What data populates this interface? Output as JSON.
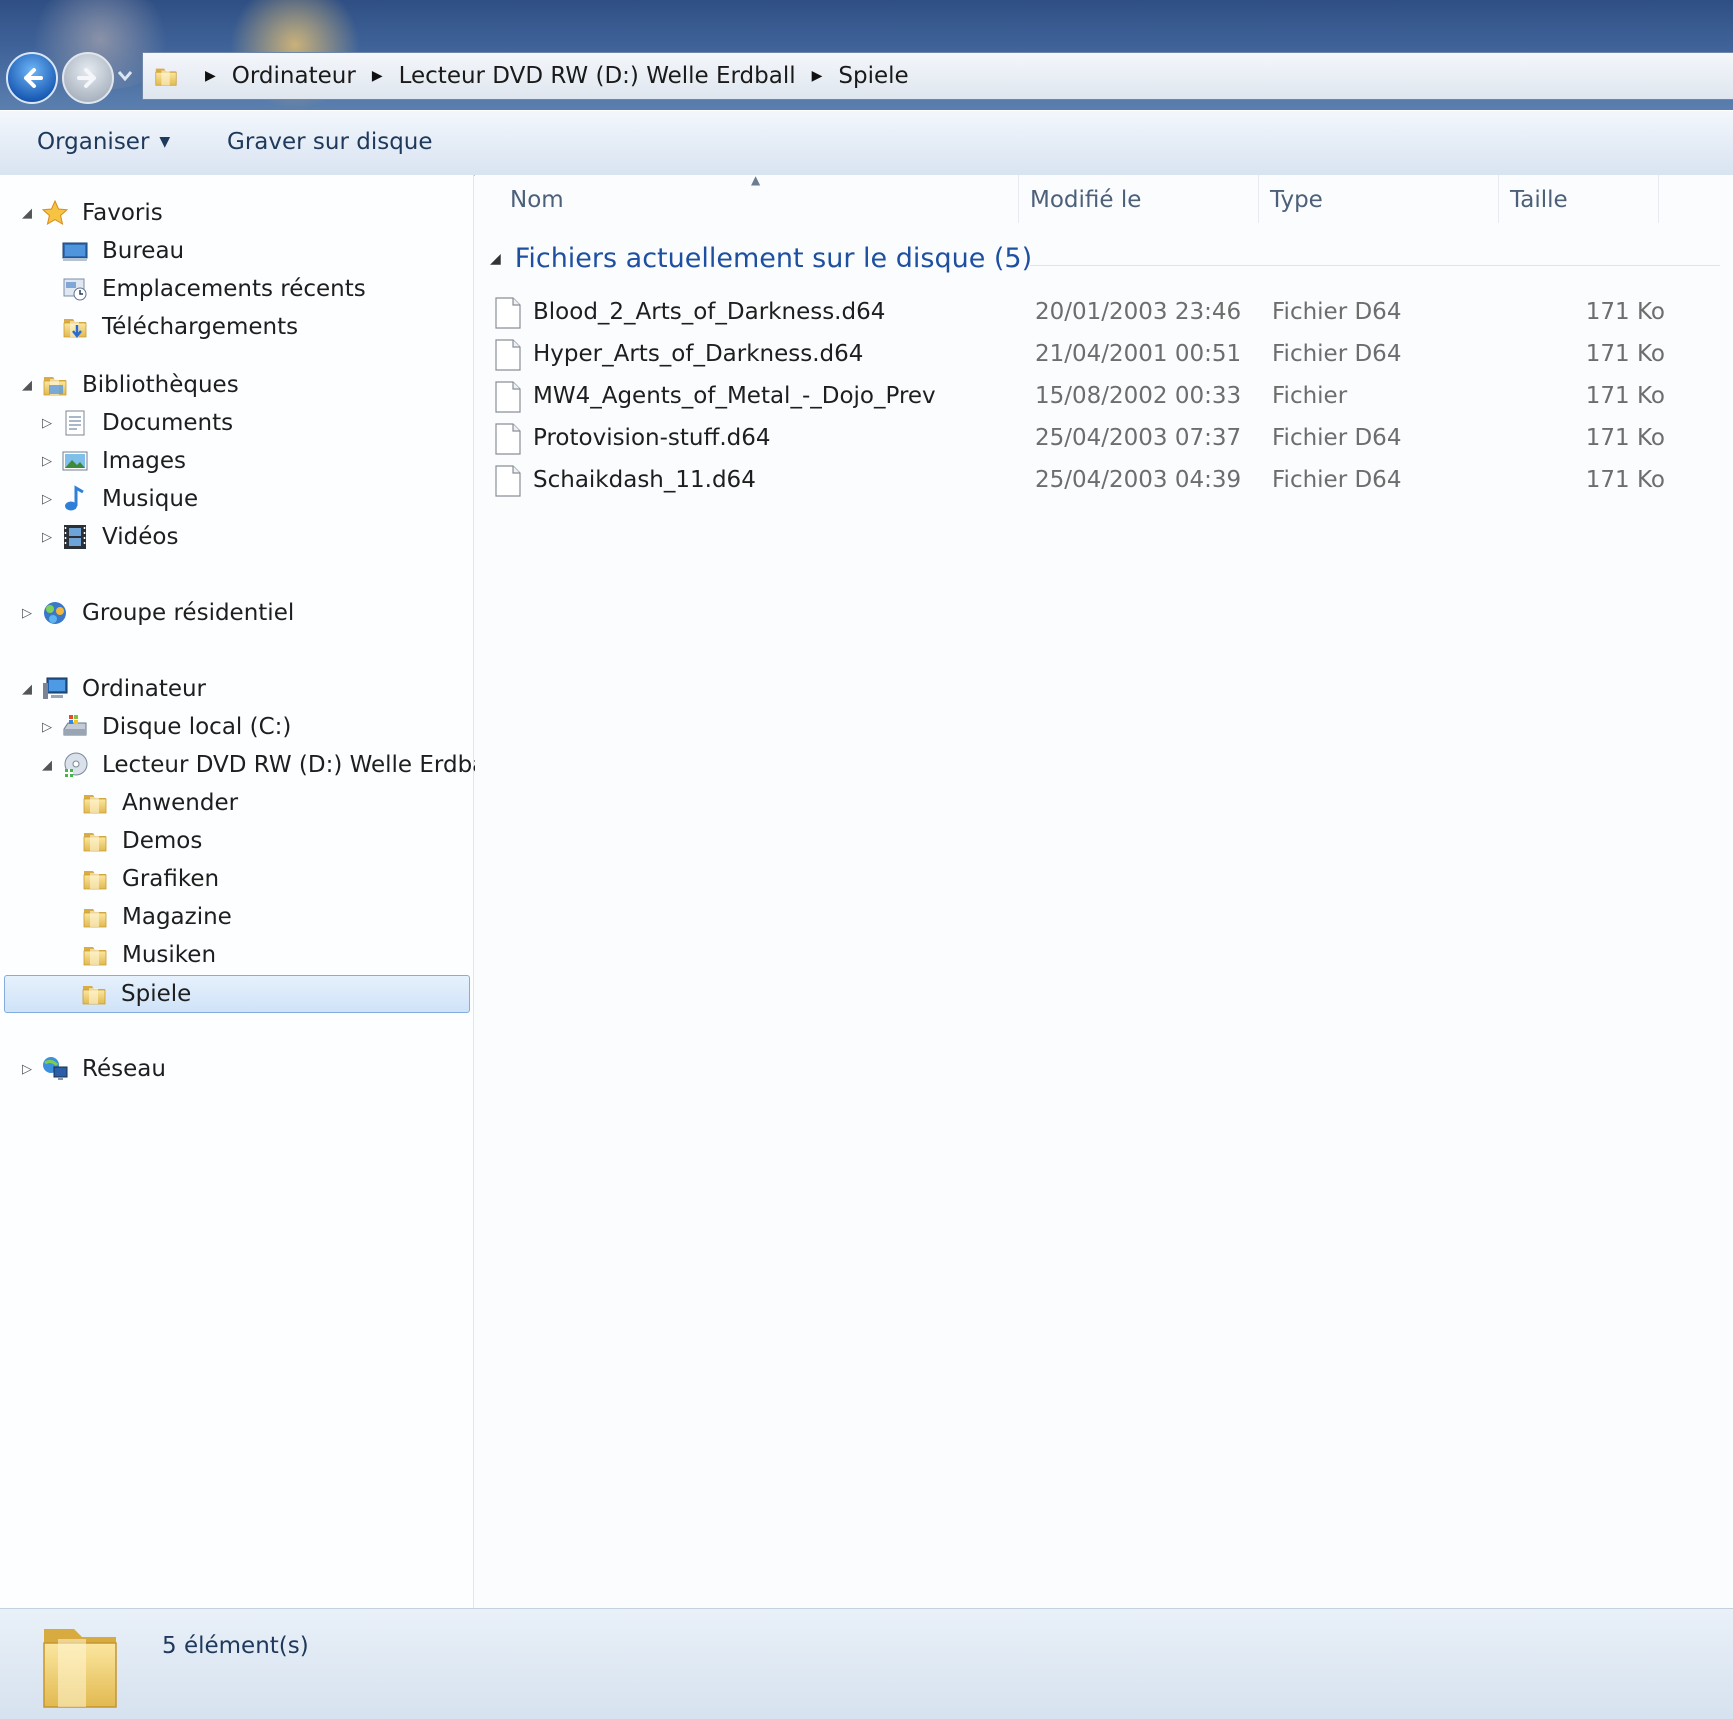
{
  "addressbar": {
    "breadcrumbs": [
      "Ordinateur",
      "Lecteur DVD RW (D:) Welle Erdball",
      "Spiele"
    ]
  },
  "commandbar": {
    "organize_label": "Organiser",
    "burn_label": "Graver sur disque"
  },
  "navigation": {
    "favorites": {
      "label": "Favoris",
      "items": [
        {
          "label": "Bureau",
          "icon": "desktop-icon"
        },
        {
          "label": "Emplacements récents",
          "icon": "recent-places-icon"
        },
        {
          "label": "Téléchargements",
          "icon": "downloads-folder-icon"
        }
      ]
    },
    "libraries": {
      "label": "Bibliothèques",
      "items": [
        {
          "label": "Documents",
          "icon": "documents-icon"
        },
        {
          "label": "Images",
          "icon": "pictures-icon"
        },
        {
          "label": "Musique",
          "icon": "music-icon"
        },
        {
          "label": "Vidéos",
          "icon": "videos-icon"
        }
      ]
    },
    "homegroup": {
      "label": "Groupe résidentiel"
    },
    "computer": {
      "label": "Ordinateur",
      "drives": [
        {
          "label": "Disque local (C:)",
          "icon": "local-disk-icon"
        },
        {
          "label": "Lecteur DVD RW (D:) Welle Erdball",
          "icon": "dvd-drive-icon"
        }
      ],
      "dvd_folders": [
        "Anwender",
        "Demos",
        "Grafiken",
        "Magazine",
        "Musiken",
        "Spiele"
      ],
      "selected_folder": "Spiele"
    },
    "network": {
      "label": "Réseau"
    }
  },
  "columns": {
    "name": "Nom",
    "modified": "Modifié le",
    "type": "Type",
    "size": "Taille"
  },
  "group": {
    "title": "Fichiers actuellement sur le disque (5)"
  },
  "files": [
    {
      "name": "Blood_2_Arts_of_Darkness.d64",
      "modified": "20/01/2003 23:46",
      "type": "Fichier D64",
      "size": "171 Ko"
    },
    {
      "name": "Hyper_Arts_of_Darkness.d64",
      "modified": "21/04/2001 00:51",
      "type": "Fichier D64",
      "size": "171 Ko"
    },
    {
      "name": "MW4_Agents_of_Metal_-_Dojo_Prev",
      "modified": "15/08/2002 00:33",
      "type": "Fichier",
      "size": "171 Ko"
    },
    {
      "name": "Protovision-stuff.d64",
      "modified": "25/04/2003 07:37",
      "type": "Fichier D64",
      "size": "171 Ko"
    },
    {
      "name": "Schaikdash_11.d64",
      "modified": "25/04/2003 04:39",
      "type": "Fichier D64",
      "size": "171 Ko"
    }
  ],
  "status": {
    "item_count": "5 élément(s)"
  },
  "colors": {
    "group_header": "#1e50a2",
    "selection_border": "#84acdd",
    "titlebar": "#3e6298"
  }
}
